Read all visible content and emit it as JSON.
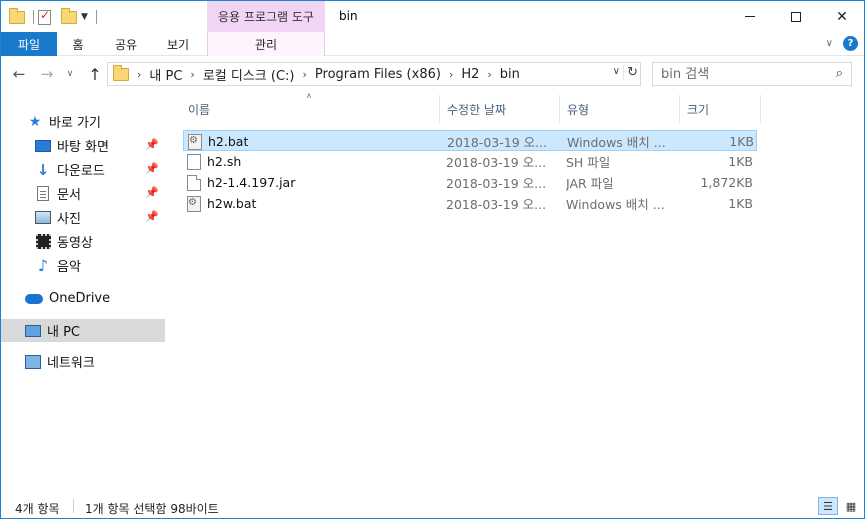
{
  "window": {
    "title": "bin",
    "context_tab_header": "응용 프로그램 도구"
  },
  "ribbon": {
    "tabs": [
      {
        "label": "파일"
      },
      {
        "label": "홈"
      },
      {
        "label": "공유"
      },
      {
        "label": "보기"
      },
      {
        "label": "관리"
      }
    ]
  },
  "address": {
    "crumbs": [
      "내 PC",
      "로컬 디스크 (C:)",
      "Program Files (x86)",
      "H2",
      "bin"
    ],
    "search_placeholder": "bin 검색"
  },
  "nav": {
    "quick_access": "바로 가기",
    "items": [
      {
        "label": "바탕 화면",
        "icon": "desktop-icon",
        "pinned": true
      },
      {
        "label": "다운로드",
        "icon": "download-icon",
        "pinned": true
      },
      {
        "label": "문서",
        "icon": "document-icon",
        "pinned": true
      },
      {
        "label": "사진",
        "icon": "pictures-icon",
        "pinned": true
      },
      {
        "label": "동영상",
        "icon": "video-icon",
        "pinned": false
      },
      {
        "label": "음악",
        "icon": "music-icon",
        "pinned": false
      }
    ],
    "onedrive": "OneDrive",
    "this_pc": "내 PC",
    "network": "네트워크"
  },
  "columns": {
    "name": "이름",
    "date": "수정한 날짜",
    "type": "유형",
    "size": "크기"
  },
  "files": [
    {
      "name": "h2.bat",
      "date": "2018-03-19 오...",
      "type": "Windows 배치 ...",
      "size": "1KB",
      "icon": "batch-file-icon",
      "selected": true
    },
    {
      "name": "h2.sh",
      "date": "2018-03-19 오...",
      "type": "SH 파일",
      "size": "1KB",
      "icon": "file-icon",
      "selected": false
    },
    {
      "name": "h2-1.4.197.jar",
      "date": "2018-03-19 오...",
      "type": "JAR 파일",
      "size": "1,872KB",
      "icon": "jar-file-icon",
      "selected": false
    },
    {
      "name": "h2w.bat",
      "date": "2018-03-19 오...",
      "type": "Windows 배치 ...",
      "size": "1KB",
      "icon": "batch-file-icon",
      "selected": false
    }
  ],
  "status": {
    "item_count": "4개 항목",
    "selection": "1개 항목 선택함 98바이트"
  },
  "colors": {
    "accent": "#1979ca",
    "context_tab": "#f2d4f5",
    "selection_bg": "#cce8ff",
    "selection_border": "#99d1ff",
    "nav_selected": "#d9d9d9"
  }
}
